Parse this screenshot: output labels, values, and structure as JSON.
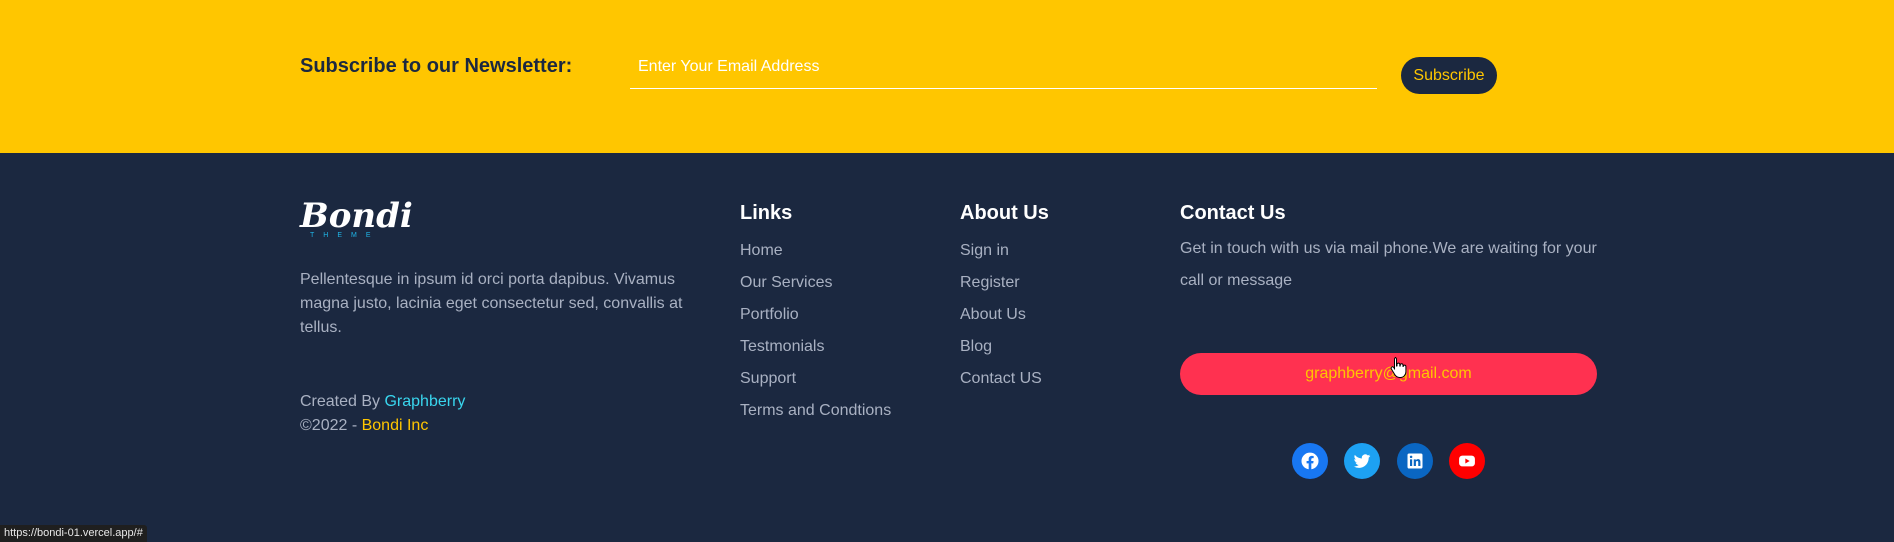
{
  "newsletter": {
    "title": "Subscribe to our Newsletter:",
    "email_placeholder": "Enter Your Email Address",
    "subscribe_label": "Subscribe"
  },
  "footer": {
    "logo": {
      "word": "Bondi",
      "sub": "THEME"
    },
    "about_text": "Pellentesque in ipsum id orci porta dapibus. Vivamus magna justo, lacinia eget consectetur sed, convallis at tellus.",
    "credit": {
      "created_by": "Created By ",
      "author": "Graphberry",
      "copyright": "©2022 - ",
      "company": "Bondi Inc"
    },
    "links": {
      "heading": "Links",
      "items": [
        "Home",
        "Our Services",
        "Portfolio",
        "Testmonials",
        "Support",
        "Terms and Condtions"
      ]
    },
    "about": {
      "heading": "About Us",
      "items": [
        "Sign in",
        "Register",
        "About Us",
        "Blog",
        "Contact US"
      ]
    },
    "contact": {
      "heading": "Contact Us",
      "text": "Get in touch with us via mail phone.We are waiting for your call or message",
      "email": "graphberry@gmail.com"
    },
    "social": [
      "facebook-icon",
      "twitter-icon",
      "linkedin-icon",
      "youtube-icon"
    ]
  },
  "statusbar": {
    "url": "https://bondi-01.vercel.app/#"
  },
  "colors": {
    "accent_yellow": "#ffc600",
    "footer_bg": "#1b2840",
    "email_button": "#ff3150",
    "link_cyan": "#39d6ee"
  }
}
